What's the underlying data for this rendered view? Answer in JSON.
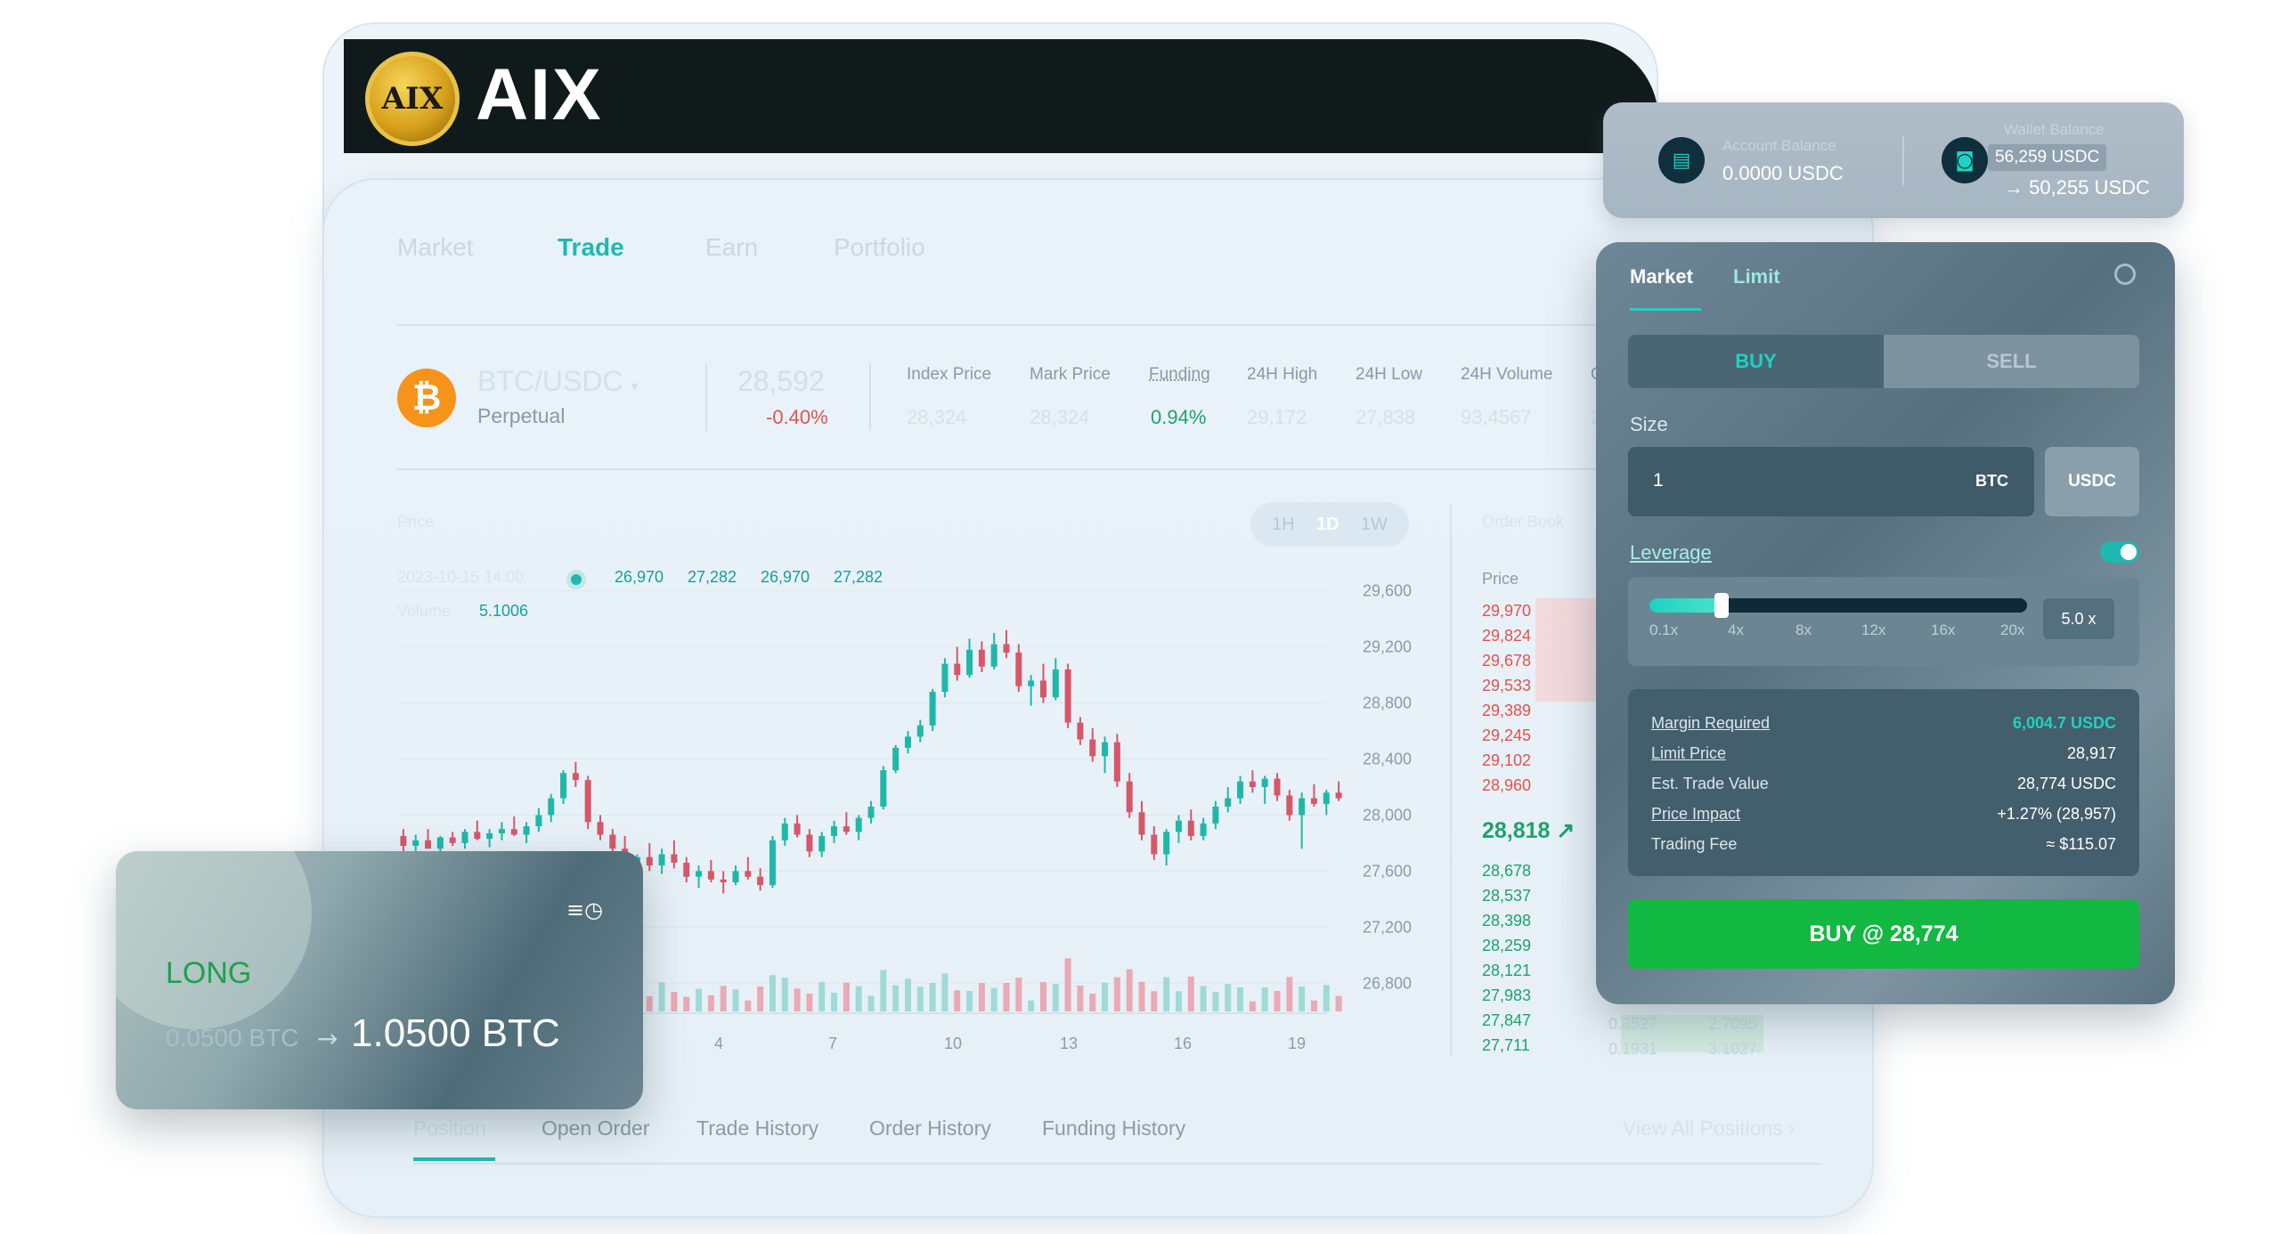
{
  "brand": {
    "logo_mark": "AIX",
    "name": "AIX"
  },
  "nav": {
    "market": "Market",
    "trade": "Trade",
    "earn": "Earn",
    "portfolio": "Portfolio"
  },
  "ticker": {
    "pair": "BTC/USDC",
    "type": "Perpetual",
    "last_price": "28,592",
    "change": "-0.40%",
    "stats": [
      {
        "label": "Index Price",
        "value": "28,324"
      },
      {
        "label": "Mark Price",
        "value": "28,324"
      },
      {
        "label": "Funding",
        "value": "0.94%"
      },
      {
        "label": "24H High",
        "value": "29,172"
      },
      {
        "label": "24H Low",
        "value": "27,838"
      },
      {
        "label": "24H Volume",
        "value": "93,4567"
      },
      {
        "label": "O",
        "value": "2"
      }
    ]
  },
  "chart": {
    "title": "Price",
    "date_text": "2023-10-15 14:00",
    "ohlc": [
      "26,970",
      "27,282",
      "26,970",
      "27,282"
    ],
    "vol_label": "Volume",
    "vol_value": "5.1006",
    "timeframes": [
      "1H",
      "1D",
      "1W"
    ],
    "selected_timeframe": "1D"
  },
  "chart_data": {
    "type": "candlestick",
    "y_ticks": [
      "29,600",
      "29,200",
      "28,800",
      "28,400",
      "28,000",
      "27,600",
      "27,200",
      "26,800"
    ],
    "x_ticks": [
      "Oct",
      "4",
      "7",
      "10",
      "13",
      "16",
      "19"
    ],
    "ylim": [
      26700,
      29700
    ],
    "candles": [
      [
        27850,
        27900,
        27700,
        27780
      ],
      [
        27780,
        27860,
        27720,
        27820
      ],
      [
        27820,
        27900,
        27760,
        27760
      ],
      [
        27760,
        27850,
        27700,
        27840
      ],
      [
        27840,
        27880,
        27780,
        27800
      ],
      [
        27800,
        27900,
        27760,
        27880
      ],
      [
        27880,
        27960,
        27820,
        27830
      ],
      [
        27830,
        27900,
        27770,
        27870
      ],
      [
        27870,
        27950,
        27820,
        27900
      ],
      [
        27900,
        27990,
        27850,
        27860
      ],
      [
        27860,
        27950,
        27800,
        27920
      ],
      [
        27920,
        28050,
        27880,
        28000
      ],
      [
        28000,
        28150,
        27950,
        28120
      ],
      [
        28120,
        28320,
        28080,
        28300
      ],
      [
        28300,
        28380,
        28200,
        28250
      ],
      [
        28250,
        28280,
        27900,
        27950
      ],
      [
        27950,
        28000,
        27820,
        27860
      ],
      [
        27860,
        27900,
        27700,
        27760
      ],
      [
        27760,
        27850,
        27550,
        27600
      ],
      [
        27600,
        27720,
        27520,
        27700
      ],
      [
        27700,
        27800,
        27600,
        27640
      ],
      [
        27640,
        27760,
        27580,
        27720
      ],
      [
        27720,
        27820,
        27620,
        27660
      ],
      [
        27660,
        27700,
        27520,
        27560
      ],
      [
        27560,
        27640,
        27480,
        27600
      ],
      [
        27600,
        27680,
        27520,
        27540
      ],
      [
        27540,
        27600,
        27440,
        27520
      ],
      [
        27520,
        27640,
        27500,
        27600
      ],
      [
        27600,
        27700,
        27540,
        27560
      ],
      [
        27560,
        27620,
        27460,
        27500
      ],
      [
        27500,
        27850,
        27480,
        27820
      ],
      [
        27820,
        27980,
        27780,
        27940
      ],
      [
        27940,
        28000,
        27840,
        27860
      ],
      [
        27860,
        27900,
        27700,
        27740
      ],
      [
        27740,
        27880,
        27700,
        27850
      ],
      [
        27850,
        27960,
        27800,
        27920
      ],
      [
        27920,
        28020,
        27860,
        27880
      ],
      [
        27880,
        28000,
        27820,
        27980
      ],
      [
        27980,
        28100,
        27940,
        28060
      ],
      [
        28060,
        28350,
        28040,
        28320
      ],
      [
        28320,
        28500,
        28300,
        28480
      ],
      [
        28480,
        28600,
        28440,
        28560
      ],
      [
        28560,
        28680,
        28520,
        28640
      ],
      [
        28640,
        28900,
        28600,
        28880
      ],
      [
        28880,
        29120,
        28840,
        29080
      ],
      [
        29080,
        29200,
        28960,
        29000
      ],
      [
        29000,
        29260,
        28980,
        29180
      ],
      [
        29180,
        29240,
        29020,
        29060
      ],
      [
        29060,
        29300,
        29040,
        29220
      ],
      [
        29220,
        29320,
        29120,
        29160
      ],
      [
        29160,
        29220,
        28880,
        28920
      ],
      [
        28920,
        29000,
        28780,
        28960
      ],
      [
        28960,
        29080,
        28800,
        28840
      ],
      [
        28840,
        29120,
        28820,
        29040
      ],
      [
        29040,
        29080,
        28620,
        28660
      ],
      [
        28660,
        28700,
        28500,
        28540
      ],
      [
        28540,
        28620,
        28380,
        28420
      ],
      [
        28420,
        28560,
        28300,
        28520
      ],
      [
        28520,
        28580,
        28200,
        28240
      ],
      [
        28240,
        28300,
        27980,
        28020
      ],
      [
        28020,
        28100,
        27820,
        27860
      ],
      [
        27860,
        27920,
        27680,
        27720
      ],
      [
        27720,
        27900,
        27640,
        27880
      ],
      [
        27880,
        28000,
        27800,
        27960
      ],
      [
        27960,
        28040,
        27820,
        27850
      ],
      [
        27850,
        27980,
        27820,
        27940
      ],
      [
        27940,
        28100,
        27900,
        28060
      ],
      [
        28060,
        28200,
        28020,
        28120
      ],
      [
        28120,
        28280,
        28080,
        28240
      ],
      [
        28240,
        28320,
        28160,
        28200
      ],
      [
        28200,
        28280,
        28080,
        28260
      ],
      [
        28260,
        28300,
        28100,
        28140
      ],
      [
        28140,
        28180,
        27960,
        28000
      ],
      [
        28000,
        28160,
        27760,
        28120
      ],
      [
        28120,
        28220,
        28060,
        28080
      ],
      [
        28080,
        28180,
        28000,
        28160
      ],
      [
        28160,
        28240,
        28100,
        28120
      ]
    ]
  },
  "orderbook": {
    "title": "Order Book",
    "price_header": "Price",
    "asks": [
      "29,970",
      "29,824",
      "29,678",
      "29,533",
      "29,389",
      "29,245",
      "29,102",
      "28,960"
    ],
    "mid": "28,818",
    "mid_arrow": "↗",
    "mid_extra": "27",
    "bids": [
      "28,678",
      "28,537",
      "28,398",
      "28,259",
      "28,121",
      "27,983",
      "27,847",
      "27,711"
    ],
    "extra": [
      {
        "size": "0.3527",
        "total": "2.7095"
      },
      {
        "size": "0.1931",
        "total": "3.1027"
      }
    ]
  },
  "bottom_tabs": [
    "Position",
    "Open Order",
    "Trade History",
    "Order History",
    "Funding History"
  ],
  "view_all": "View All Positions",
  "balance": {
    "account_label": "Account Balance",
    "account_value": "0.0000 USDC",
    "wallet_label": "Wallet Balance",
    "wallet_value": "56,259 USDC",
    "wallet_after": "→  50,255 USDC"
  },
  "order_panel": {
    "tabs": [
      "Market",
      "Limit"
    ],
    "buy": "BUY",
    "sell": "SELL",
    "size_label": "Size",
    "size_value": "1",
    "size_unit": "BTC",
    "alt_unit": "USDC",
    "leverage_label": "Leverage",
    "leverage_ticks": [
      "0.1x",
      "4x",
      "8x",
      "12x",
      "16x",
      "20x"
    ],
    "leverage_value": "5.0  x",
    "leverage_fraction": 0.19,
    "summary": [
      {
        "label": "Margin Required",
        "value": "6,004.7 USDC"
      },
      {
        "label": "Limit Price",
        "value": "28,917"
      },
      {
        "label": "Est. Trade Value",
        "value": "28,774 USDC"
      },
      {
        "label": "Price Impact",
        "value": "+1.27% (28,957)"
      },
      {
        "label": "Trading Fee",
        "value": "≈ $115.07"
      }
    ],
    "submit": "BUY @ 28,774"
  },
  "position_card": {
    "side": "LONG",
    "from": "0.0500 BTC",
    "arrow": "→",
    "to": "1.0500 BTC",
    "menu_icon": "≡◷"
  },
  "colors": {
    "accent": "#1fb8b0",
    "up": "#1ea26c",
    "down": "#e2524c",
    "buy": "#13b843"
  }
}
